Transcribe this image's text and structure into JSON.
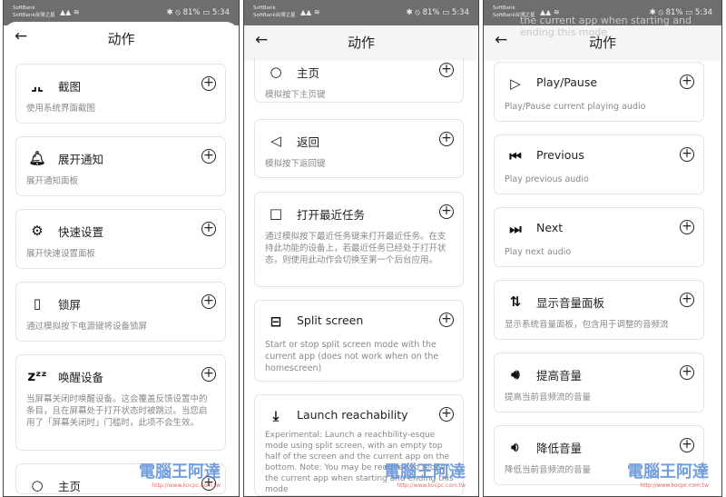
{
  "status": {
    "carrier1": "SoftBank",
    "carrier2": "SoftBank台灣之星",
    "signal": "▲▲ ≋",
    "right": "✱ ⦸ 81% ▭ 5:34"
  },
  "header": {
    "title": "动作",
    "back": "←"
  },
  "watermark": {
    "text": "電腦王阿達",
    "url": "http://www.kocpc.com.tw"
  },
  "panels": [
    {
      "ghost": "",
      "cards": [
        {
          "icon": "screenshot-icon",
          "glyph": "⌟⌞",
          "title": "截图",
          "desc": "使用系统界面截图"
        },
        {
          "icon": "bell-icon",
          "glyph": "🔔︎",
          "title": "展开通知",
          "desc": "展开通知面板"
        },
        {
          "icon": "gear-icon",
          "glyph": "⚙",
          "title": "快速设置",
          "desc": "展开快速设置面板"
        },
        {
          "icon": "lock-phone-icon",
          "glyph": "▯",
          "title": "锁屏",
          "desc": "通过模拟按下电源键将设备锁屏"
        },
        {
          "icon": "sleep-icon",
          "glyph": "zᶻᶻ",
          "title": "唤醒设备",
          "desc": "当屏幕关闭时唤醒设备。这会覆盖反馈设置中的条目，且在屏幕处于打开状态时被跳过。当您启用了「屏幕关闭时」门槛时，此项不会生效。"
        },
        {
          "icon": "circle-icon",
          "glyph": "○",
          "title": "主页",
          "desc": ""
        }
      ]
    },
    {
      "ghost": "",
      "cards": [
        {
          "icon": "circle-icon",
          "glyph": "○",
          "title": "主页",
          "desc": "模拟按下主页键"
        },
        {
          "icon": "triangle-back-icon",
          "glyph": "◁",
          "title": "返回",
          "desc": "模拟按下返回键"
        },
        {
          "icon": "square-icon",
          "glyph": "□",
          "title": "打开最近任务",
          "desc": "通过模拟按下最近任务键来打开最近任务。在支持此功能的设备上，若最近任务已经处于打开状态，则使用此动作会切换至第一个后台应用。"
        },
        {
          "icon": "split-screen-icon",
          "glyph": "⊟",
          "title": "Split screen",
          "desc": "Start or stop split screen mode with the current app (does not work when on the homescreen)"
        },
        {
          "icon": "reachability-icon",
          "glyph": "⤓",
          "title": "Launch reachability",
          "desc": "Experimental: Launch a reachbility-esque mode using split screen, with an empty top half of the screen and the current app on the bottom. Note: You may be required to reopen the current app when starting and ending this mode"
        }
      ]
    },
    {
      "ghost": "the current app when starting and ending this mode",
      "cards": [
        {
          "icon": "play-icon",
          "glyph": "▷",
          "title": "Play/Pause",
          "desc": "Play/Pause current playing audio"
        },
        {
          "icon": "previous-icon",
          "glyph": "⏮",
          "title": "Previous",
          "desc": "Play previous audio"
        },
        {
          "icon": "next-icon",
          "glyph": "⏭",
          "title": "Next",
          "desc": "Play next audio"
        },
        {
          "icon": "volume-panel-icon",
          "glyph": "⇅",
          "title": "显示音量面板",
          "desc": "显示系统音量面板，包含用于调整的音频流"
        },
        {
          "icon": "volume-up-icon",
          "glyph": "🔊︎",
          "title": "提高音量",
          "desc": "提高当前音频流的音量"
        },
        {
          "icon": "volume-down-icon",
          "glyph": "🔉︎",
          "title": "降低音量",
          "desc": "降低当前音频流的音量"
        }
      ]
    }
  ]
}
